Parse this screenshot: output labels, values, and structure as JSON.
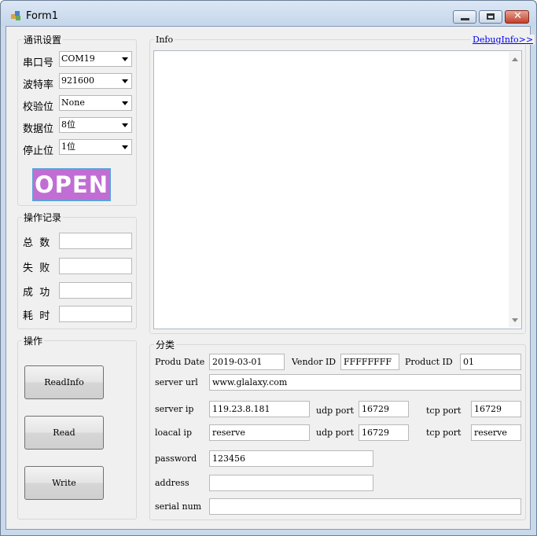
{
  "window": {
    "title": "Form1"
  },
  "comm": {
    "group_label": "通讯设置",
    "port_label": "串口号",
    "port_value": "COM19",
    "baud_label": "波特率",
    "baud_value": "921600",
    "parity_label": "校验位",
    "parity_value": "None",
    "databits_label": "数据位",
    "databits_value": "8位",
    "stopbits_label": "停止位",
    "stopbits_value": "1位",
    "open_label": "OPEN"
  },
  "log": {
    "group_label": "操作记录",
    "total_label": "总  数",
    "total_value": "",
    "fail_label": "失  败",
    "fail_value": "",
    "success_label": "成  功",
    "success_value": "",
    "time_label": "耗  时",
    "time_value": ""
  },
  "ops": {
    "group_label": "操作",
    "readinfo_label": "ReadInfo",
    "read_label": "Read",
    "write_label": "Write"
  },
  "info": {
    "group_label": "Info",
    "debug_link": "DebugInfo>>",
    "text": ""
  },
  "cat": {
    "group_label": "分类",
    "produ_date_label": "Produ Date",
    "produ_date_value": "2019-03-01",
    "vendor_label": "Vendor ID",
    "vendor_value": "FFFFFFFF",
    "product_label": "Product ID",
    "product_value": "01",
    "server_url_label": "server url",
    "server_url_value": "www.glalaxy.com",
    "server_ip_label": "server ip",
    "server_ip_value": "119.23.8.181",
    "udp_port_label": "udp port",
    "server_udp_value": "16729",
    "tcp_port_label": "tcp port",
    "server_tcp_value": "16729",
    "local_ip_label": "loacal ip",
    "local_ip_value": "reserve",
    "local_udp_label": "udp port",
    "local_udp_value": "16729",
    "local_tcp_label": "tcp port",
    "local_tcp_value": "reserve",
    "password_label": "password",
    "password_value": "123456",
    "address_label": "address",
    "address_value": "",
    "serial_label": "serial num",
    "serial_value": ""
  }
}
